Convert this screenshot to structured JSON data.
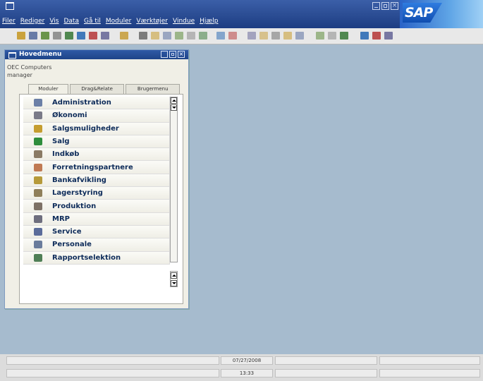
{
  "menu": {
    "items": [
      "Filer",
      "Rediger",
      "Vis",
      "Data",
      "Gå til",
      "Moduler",
      "Værktøjer",
      "Vindue",
      "Hjælp"
    ]
  },
  "brand": {
    "logo": "SAP"
  },
  "toolbar": {
    "icons": [
      "print-preview-icon",
      "print-icon",
      "email-icon",
      "sms-icon",
      "export-excel-icon",
      "export-word-icon",
      "pdf-icon",
      "launch-application-icon",
      "lock-screen-icon",
      "find-icon",
      "add-icon",
      "first-record-icon",
      "previous-record-icon",
      "next-record-icon",
      "last-record-icon",
      "filter-icon",
      "sort-icon",
      "refresh-record-icon",
      "base-document-icon",
      "target-document-icon",
      "gross-profit-icon",
      "journal-icon",
      "layout-designer-icon",
      "settings-icon",
      "form-settings-icon",
      "alerts-icon",
      "messages-icon",
      "help-icon"
    ]
  },
  "main_menu": {
    "title": "Hovedmenu",
    "company": "OEC Computers",
    "user": "manager",
    "tabs": [
      "Moduler",
      "Drag&Relate",
      "Brugermenu"
    ],
    "modules": [
      {
        "label": "Administration",
        "icon": "administration-icon",
        "color": "#6b7fa6"
      },
      {
        "label": "Økonomi",
        "icon": "financials-icon",
        "color": "#7a7a88"
      },
      {
        "label": "Salgsmuligheder",
        "icon": "opportunities-icon",
        "color": "#c59d2f"
      },
      {
        "label": "Salg",
        "icon": "sales-icon",
        "color": "#2e8d3c"
      },
      {
        "label": "Indkøb",
        "icon": "purchasing-icon",
        "color": "#8a7a64"
      },
      {
        "label": "Forretningspartnere",
        "icon": "business-partners-icon",
        "color": "#c07a53"
      },
      {
        "label": "Bankafvikling",
        "icon": "banking-icon",
        "color": "#b69a3a"
      },
      {
        "label": "Lagerstyring",
        "icon": "inventory-icon",
        "color": "#8f7f5a"
      },
      {
        "label": "Produktion",
        "icon": "production-icon",
        "color": "#7d7166"
      },
      {
        "label": "MRP",
        "icon": "mrp-icon",
        "color": "#6e6e7e"
      },
      {
        "label": "Service",
        "icon": "service-icon",
        "color": "#5b6c9a"
      },
      {
        "label": "Personale",
        "icon": "human-resources-icon",
        "color": "#6a7c9c"
      },
      {
        "label": "Rapportselektion",
        "icon": "reports-icon",
        "color": "#4f7f56"
      }
    ]
  },
  "status": {
    "date": "07/27/2008",
    "time": "13:33"
  },
  "colors": {
    "title_bar": "#1d3d82",
    "workspace": "#a6bbce",
    "module_text": "#0e2c5a"
  }
}
